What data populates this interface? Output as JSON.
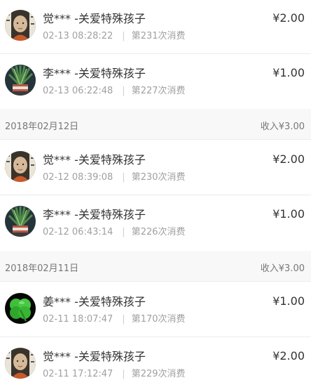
{
  "currency_symbol": "¥",
  "entries": [
    {
      "name": "觉*** -关爱特殊孩子",
      "time": "02-13 08:28:22",
      "count": "第231次消费",
      "amount": "2.00",
      "avatar_icon": "monk-avatar-icon"
    },
    {
      "name": "李*** -关爱特殊孩子",
      "time": "02-13 06:22:48",
      "count": "第227次消费",
      "amount": "1.00",
      "avatar_icon": "plant-avatar-icon"
    },
    {
      "name": "觉*** -关爱特殊孩子",
      "time": "02-12 08:39:08",
      "count": "第230次消费",
      "amount": "2.00",
      "avatar_icon": "monk-avatar-icon"
    },
    {
      "name": "李*** -关爱特殊孩子",
      "time": "02-12 06:43:14",
      "count": "第226次消费",
      "amount": "1.00",
      "avatar_icon": "plant-avatar-icon"
    },
    {
      "name": "姜*** -关爱特殊孩子",
      "time": "02-11 18:07:47",
      "count": "第170次消费",
      "amount": "1.00",
      "avatar_icon": "clover-avatar-icon"
    },
    {
      "name": "觉*** -关爱特殊孩子",
      "time": "02-11 17:12:47",
      "count": "第229次消费",
      "amount": "2.00",
      "avatar_icon": "monk-avatar-icon"
    }
  ],
  "date_headers": [
    {
      "date": "2018年02月12日",
      "income_label": "收入",
      "income": "3.00"
    },
    {
      "date": "2018年02月11日",
      "income_label": "收入",
      "income": "3.00"
    }
  ],
  "colors": {
    "text": "#333333",
    "muted": "#a0a0a0",
    "header_bg": "#f8f8f8",
    "divider": "#ececec"
  }
}
